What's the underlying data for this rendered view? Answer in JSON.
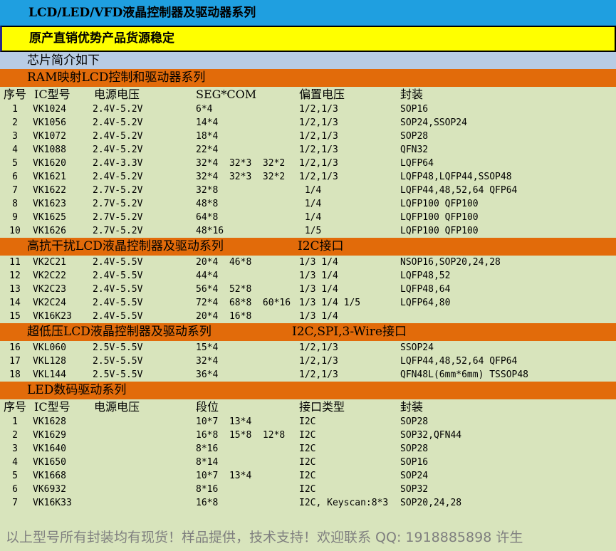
{
  "title": "LCD/LED/VFD液晶控制器及驱动器系列",
  "slogan": "原产直销优势产品货源稳定",
  "intro": "芯片简介如下",
  "lcd_header": [
    "序号",
    "IC型号",
    "电源电压",
    "SEG*COM",
    "偏置电压",
    "封装"
  ],
  "led_header": [
    "序号",
    "IC型号",
    "电源电压",
    "段位",
    "接口类型",
    "封装"
  ],
  "sections": {
    "ram": {
      "title": "RAM映射LCD控制和驱动器系列",
      "note": "",
      "rows": [
        {
          "no": "1",
          "ic": "VK1024",
          "volt": "2.4V-5.2V",
          "seg": "6*4",
          "bias": "1/2,1/3",
          "pkg": "SOP16"
        },
        {
          "no": "2",
          "ic": "VK1056",
          "volt": "2.4V-5.2V",
          "seg": "14*4",
          "bias": "1/2,1/3",
          "pkg": "SOP24,SSOP24"
        },
        {
          "no": "3",
          "ic": "VK1072",
          "volt": "2.4V-5.2V",
          "seg": "18*4",
          "bias": "1/2,1/3",
          "pkg": "SOP28"
        },
        {
          "no": "4",
          "ic": "VK1088",
          "volt": "2.4V-5.2V",
          "seg": "22*4",
          "bias": "1/2,1/3",
          "pkg": "QFN32"
        },
        {
          "no": "5",
          "ic": "VK1620",
          "volt": "2.4V-3.3V",
          "seg": "32*4  32*3  32*2",
          "bias": "1/2,1/3",
          "pkg": "LQFP64"
        },
        {
          "no": "6",
          "ic": "VK1621",
          "volt": "2.4V-5.2V",
          "seg": "32*4  32*3  32*2",
          "bias": "1/2,1/3",
          "pkg": "LQFP48,LQFP44,SSOP48"
        },
        {
          "no": "7",
          "ic": "VK1622",
          "volt": "2.7V-5.2V",
          "seg": "32*8",
          "bias": " 1/4",
          "pkg": "LQFP44,48,52,64 QFP64"
        },
        {
          "no": "8",
          "ic": "VK1623",
          "volt": "2.7V-5.2V",
          "seg": "48*8",
          "bias": " 1/4",
          "pkg": "LQFP100 QFP100"
        },
        {
          "no": "9",
          "ic": "VK1625",
          "volt": "2.7V-5.2V",
          "seg": "64*8",
          "bias": " 1/4",
          "pkg": "LQFP100 QFP100"
        },
        {
          "no": "10",
          "ic": "VK1626",
          "volt": "2.7V-5.2V",
          "seg": "48*16",
          "bias": " 1/5",
          "pkg": "LQFP100 QFP100"
        }
      ]
    },
    "anti": {
      "title": "高抗干扰LCD液晶控制器及驱动系列",
      "note": "I2C接口",
      "rows": [
        {
          "no": "11",
          "ic": "VK2C21",
          "volt": "2.4V-5.5V",
          "seg": "20*4  46*8",
          "bias": "1/3 1/4",
          "pkg": "NSOP16,SOP20,24,28"
        },
        {
          "no": "12",
          "ic": "VK2C22",
          "volt": "2.4V-5.5V",
          "seg": "44*4",
          "bias": "1/3 1/4",
          "pkg": "LQFP48,52"
        },
        {
          "no": "13",
          "ic": "VK2C23",
          "volt": "2.4V-5.5V",
          "seg": "56*4  52*8",
          "bias": "1/3 1/4",
          "pkg": "LQFP48,64"
        },
        {
          "no": "14",
          "ic": "VK2C24",
          "volt": "2.4V-5.5V",
          "seg": "72*4  68*8  60*16",
          "bias": "1/3 1/4 1/5",
          "pkg": "LQFP64,80"
        },
        {
          "no": "15",
          "ic": "VK16K23",
          "volt": "2.4V-5.5V",
          "seg": "20*4  16*8",
          "bias": "1/3 1/4",
          "pkg": ""
        }
      ]
    },
    "lowv": {
      "title": "超低压LCD液晶控制器及驱动系列",
      "note": "I2C,SPI,3-Wire接口",
      "rows": [
        {
          "no": "16",
          "ic": "VKL060",
          "volt": "2.5V-5.5V",
          "seg": "15*4",
          "bias": "1/2,1/3",
          "pkg": "SSOP24"
        },
        {
          "no": "17",
          "ic": "VKL128",
          "volt": "2.5V-5.5V",
          "seg": "32*4",
          "bias": "1/2,1/3",
          "pkg": "LQFP44,48,52,64 QFP64"
        },
        {
          "no": "18",
          "ic": "VKL144",
          "volt": "2.5V-5.5V",
          "seg": "36*4",
          "bias": "1/2,1/3",
          "pkg": "QFN48L(6mm*6mm) TSSOP48"
        }
      ]
    },
    "led": {
      "title": "LED数码驱动系列",
      "note": "",
      "rows": [
        {
          "no": "1",
          "ic": "VK1628",
          "volt": "",
          "seg": "10*7  13*4",
          "bias": "I2C",
          "pkg": "SOP28"
        },
        {
          "no": "2",
          "ic": "VK1629",
          "volt": "",
          "seg": "16*8  15*8  12*8",
          "bias": "I2C",
          "pkg": "SOP32,QFN44"
        },
        {
          "no": "3",
          "ic": "VK1640",
          "volt": "",
          "seg": "8*16",
          "bias": "I2C",
          "pkg": "SOP28"
        },
        {
          "no": "4",
          "ic": "VK1650",
          "volt": "",
          "seg": "8*14",
          "bias": "I2C",
          "pkg": "SOP16"
        },
        {
          "no": "5",
          "ic": "VK1668",
          "volt": "",
          "seg": "10*7  13*4",
          "bias": "I2C",
          "pkg": "SOP24"
        },
        {
          "no": "6",
          "ic": "VK6932",
          "volt": "",
          "seg": "8*16",
          "bias": "I2C",
          "pkg": "SOP32"
        },
        {
          "no": "7",
          "ic": "VK16K33",
          "volt": "",
          "seg": "16*8",
          "bias": "I2C, Keyscan:8*3",
          "pkg": "SOP20,24,28"
        }
      ]
    }
  },
  "footer": "以上型号所有封装均有现货！样品提供，技术支持！欢迎联系 QQ: 1918885898 许生"
}
